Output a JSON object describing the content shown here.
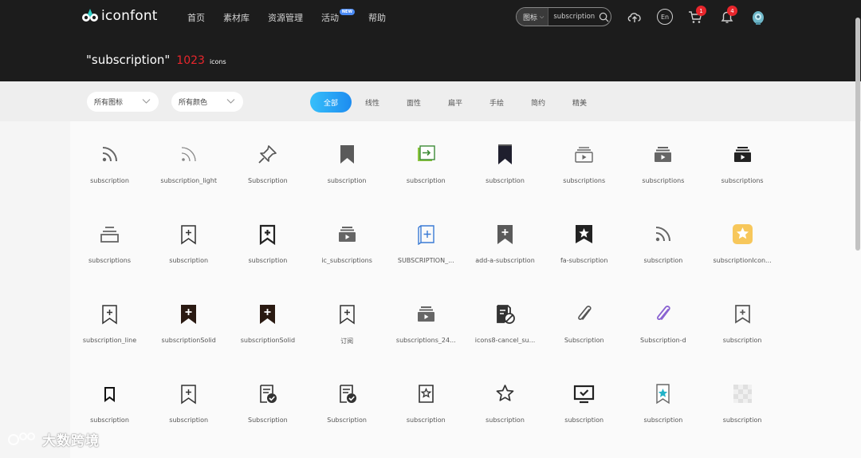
{
  "brand": {
    "name": "iconfont"
  },
  "nav": [
    {
      "label": "首页"
    },
    {
      "label": "素材库"
    },
    {
      "label": "资源管理"
    },
    {
      "label": "活动",
      "badge": "NEW"
    },
    {
      "label": "帮助"
    }
  ],
  "search": {
    "type_label": "图标",
    "value": "subscription"
  },
  "header_actions": {
    "language_label": "En",
    "cart_count": "1",
    "notification_count": "4"
  },
  "results": {
    "query": "\"subscription\"",
    "count": "1023",
    "unit": "icons"
  },
  "filters": {
    "all_icons": "所有图标",
    "all_colors": "所有颜色",
    "styles": [
      "全部",
      "线性",
      "面性",
      "扁平",
      "手绘",
      "简约",
      "精美"
    ],
    "active_style": "全部"
  },
  "colors": {
    "accent": "#1d8cf0",
    "badge_red": "#e8262c",
    "topbar": "#1c1c1c"
  },
  "icons": [
    {
      "name": "subscription",
      "icon": "rss-icon"
    },
    {
      "name": "subscription_light",
      "icon": "rss-light-icon"
    },
    {
      "name": "Subscription",
      "icon": "pin-icon"
    },
    {
      "name": "subscription",
      "icon": "bookmark-solid-icon"
    },
    {
      "name": "subscription",
      "icon": "enter-box-icon"
    },
    {
      "name": "subscription",
      "icon": "bookmark-dark-icon"
    },
    {
      "name": "subscriptions",
      "icon": "video-stack-outline-icon"
    },
    {
      "name": "subscriptions",
      "icon": "video-stack-gray-icon"
    },
    {
      "name": "subscriptions",
      "icon": "video-stack-dark-icon"
    },
    {
      "name": "subscriptions",
      "icon": "stack-outline-icon"
    },
    {
      "name": "subscription",
      "icon": "bookmark-plus-outline-icon"
    },
    {
      "name": "subscription",
      "icon": "bookmark-plus-bold-icon"
    },
    {
      "name": "ic_subscriptions",
      "icon": "video-stack-gray-icon"
    },
    {
      "name": "SUBSCRIPTION_...",
      "icon": "book-plus-blue-icon"
    },
    {
      "name": "add-a-subscription",
      "icon": "bookmark-plus-gray-icon"
    },
    {
      "name": "fa-subscription",
      "icon": "bookmark-star-icon"
    },
    {
      "name": "subscription",
      "icon": "rss-icon"
    },
    {
      "name": "subscriptionIcon...",
      "icon": "star-yellow-icon"
    },
    {
      "name": "subscription_line",
      "icon": "bookmark-plus-outline-icon"
    },
    {
      "name": "subscriptionSolid",
      "icon": "bookmark-plus-solid-icon"
    },
    {
      "name": "subscriptionSolid",
      "icon": "bookmark-plus-solid-icon"
    },
    {
      "name": "订阅",
      "icon": "bookmark-plus-outline-icon"
    },
    {
      "name": "subscriptions_24...",
      "icon": "video-stack-gray-icon"
    },
    {
      "name": "icons8-cancel_su...",
      "icon": "doc-cancel-icon"
    },
    {
      "name": "Subscription",
      "icon": "paperclip-icon"
    },
    {
      "name": "Subscription-d",
      "icon": "paperclip-purple-icon"
    },
    {
      "name": "subscription",
      "icon": "bookmark-plus-small-icon"
    },
    {
      "name": "subscription",
      "icon": "bookmark-small-icon"
    },
    {
      "name": "subscription",
      "icon": "bookmark-plus-outline-icon"
    },
    {
      "name": "Subscription",
      "icon": "doc-check-icon"
    },
    {
      "name": "Subscription",
      "icon": "doc-check-icon"
    },
    {
      "name": "subscription",
      "icon": "bookmark-star-outline-icon"
    },
    {
      "name": "subscription",
      "icon": "star-outline-icon"
    },
    {
      "name": "subscription",
      "icon": "monitor-check-icon"
    },
    {
      "name": "subscription",
      "icon": "bookmark-star-teal-icon"
    },
    {
      "name": "subscription",
      "icon": "placeholder-icon"
    }
  ],
  "watermark": {
    "text": "大数跨境"
  }
}
